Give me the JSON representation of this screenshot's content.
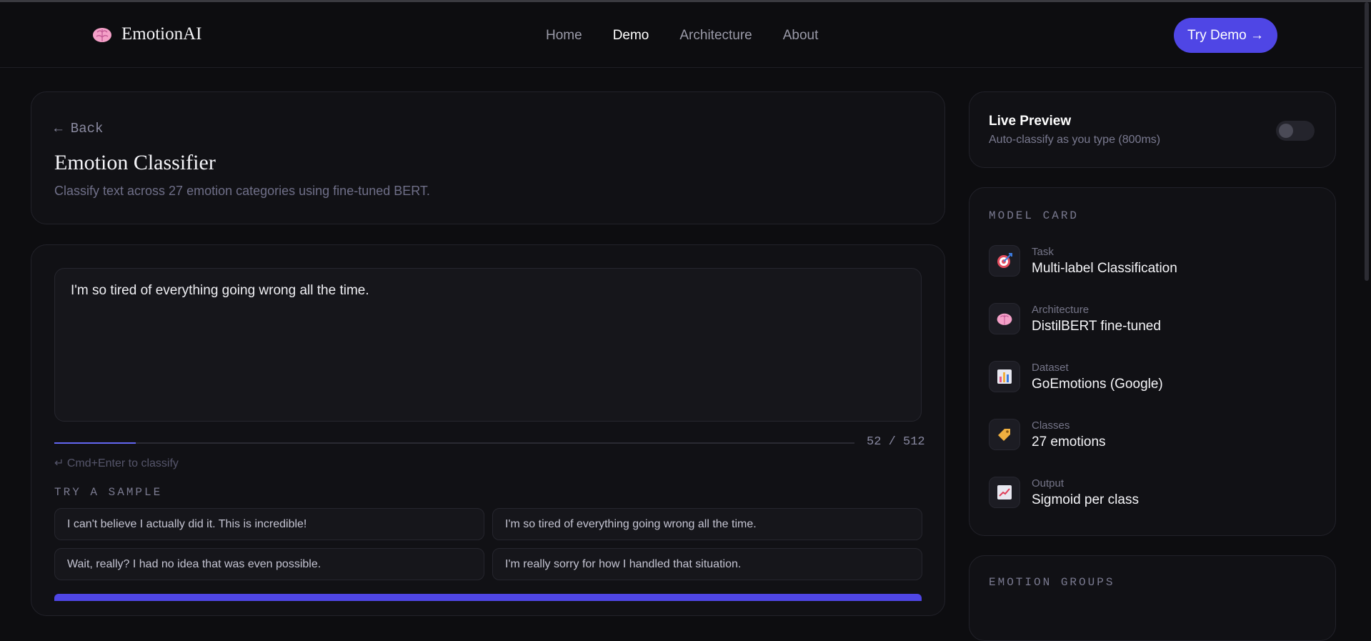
{
  "brand": {
    "name": "EmotionAI",
    "icon": "brain-icon"
  },
  "nav": {
    "links": [
      "Home",
      "Demo",
      "Architecture",
      "About"
    ],
    "active": "Demo",
    "cta": "Try Demo →"
  },
  "header_card": {
    "back": "← Back",
    "title": "Emotion Classifier",
    "subtitle": "Classify text across 27 emotion categories using fine-tuned BERT."
  },
  "input_card": {
    "text": "I'm so tired of everything going wrong all the time.",
    "char_count": "52 / 512",
    "char_progress": 0.1016,
    "hint": "↵ Cmd+Enter to classify",
    "samples_label": "TRY A SAMPLE",
    "samples": [
      "I can't believe I actually did it. This is incredible!",
      "I'm so tired of everything going wrong all the time.",
      "Wait, really? I had no idea that was even possible.",
      "I'm really sorry for how I handled that situation."
    ]
  },
  "live_preview": {
    "title": "Live Preview",
    "subtitle": "Auto-classify as you type (800ms)",
    "enabled": false
  },
  "model_card": {
    "label": "MODEL CARD",
    "items": [
      {
        "key": "Task",
        "value": "Multi-label Classification",
        "icon": "target-icon"
      },
      {
        "key": "Architecture",
        "value": "DistilBERT fine-tuned",
        "icon": "brain-icon"
      },
      {
        "key": "Dataset",
        "value": "GoEmotions (Google)",
        "icon": "bar-chart-icon"
      },
      {
        "key": "Classes",
        "value": "27 emotions",
        "icon": "tag-icon"
      },
      {
        "key": "Output",
        "value": "Sigmoid per class",
        "icon": "trend-chart-icon"
      }
    ]
  },
  "emotion_groups": {
    "label": "EMOTION GROUPS"
  },
  "colors": {
    "accent": "#4f46e5",
    "background": "#0d0d10",
    "card": "#111115"
  }
}
